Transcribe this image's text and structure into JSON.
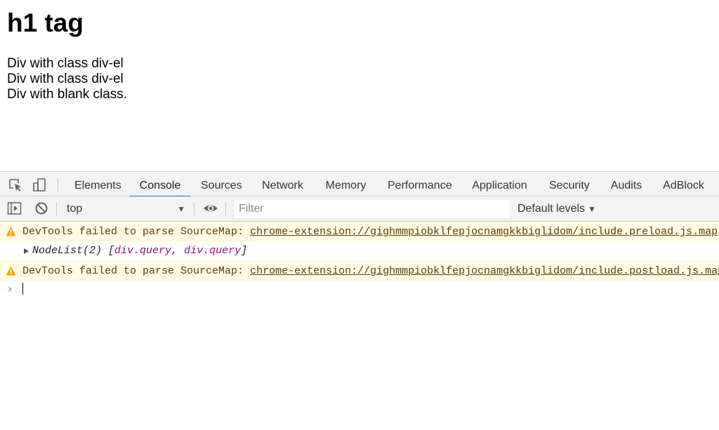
{
  "page": {
    "heading": "h1 tag",
    "lines": [
      "Div with class div-el",
      "Div with class div-el",
      "Div with blank class."
    ]
  },
  "devtools": {
    "tabs": [
      "Elements",
      "Console",
      "Sources",
      "Network",
      "Memory",
      "Performance",
      "Application",
      "Security",
      "Audits",
      "AdBlock"
    ],
    "active_tab": "Console",
    "toolbar": {
      "context": "top",
      "filter_placeholder": "Filter",
      "levels": "Default levels"
    },
    "messages": {
      "warning1": {
        "prefix": "DevTools failed to parse SourceMap: ",
        "link": "chrome-extension://gighmmpiobklfepjocnamgkkbiglidom/include.preload.js.map"
      },
      "log": {
        "prefix": "NodeList(2) [",
        "item1": "div.query",
        "sep": ", ",
        "item2": "div.query",
        "suffix": "]"
      },
      "warning2": {
        "prefix": "DevTools failed to parse SourceMap: ",
        "link": "chrome-extension://gighmmpiobklfepjocnamgkkbiglidom/include.postload.js.map"
      }
    },
    "colors": {
      "accent": "#1a73e8",
      "warning_bg": "#fffbe5",
      "warning_text": "#5c3c00",
      "warning_icon": "#f2a600",
      "object_item": "#881280"
    }
  }
}
